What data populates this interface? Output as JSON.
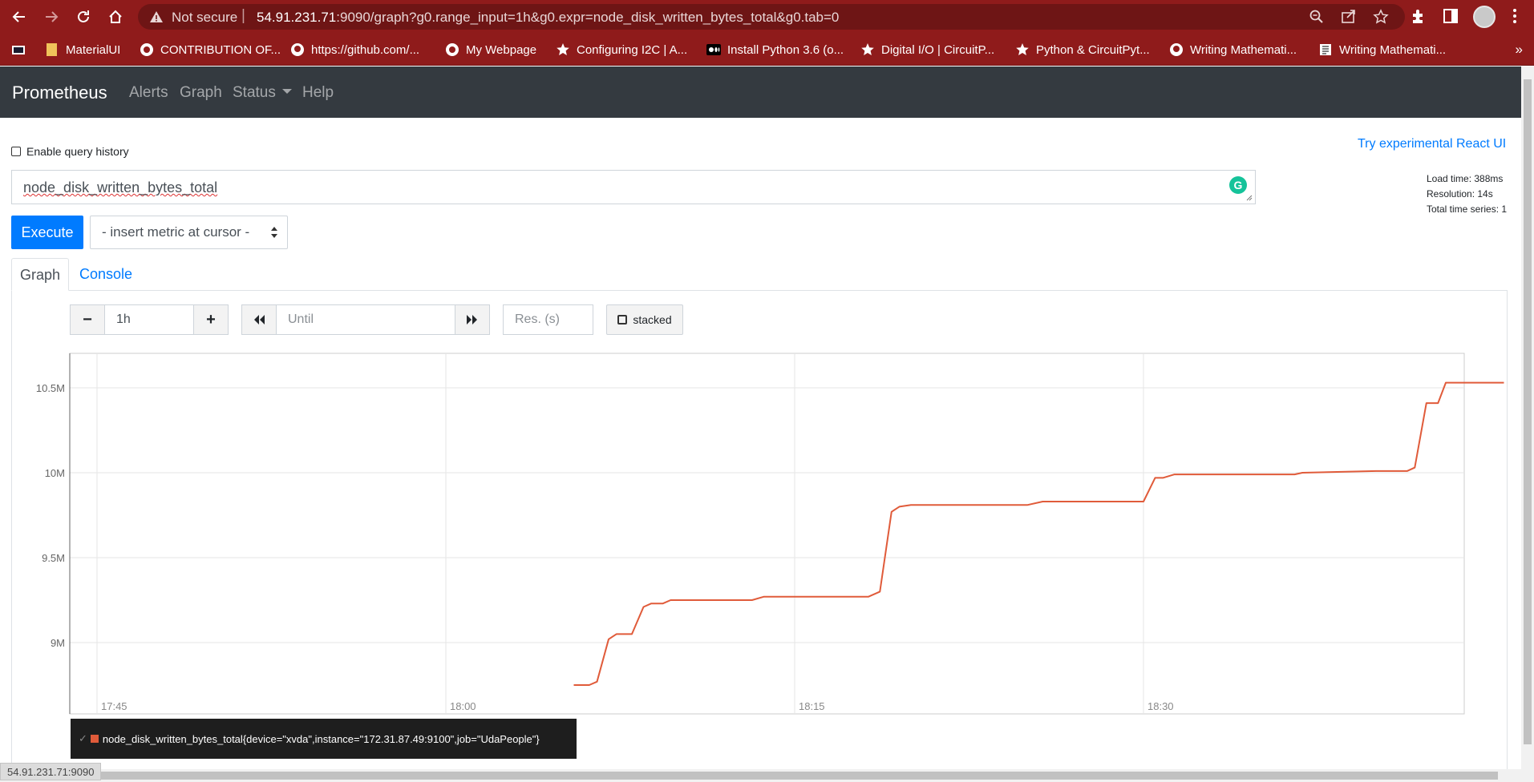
{
  "browser": {
    "not_secure": "Not secure",
    "url_host": "54.91.231.71",
    "url_rest": ":9090/graph?g0.range_input=1h&g0.expr=node_disk_written_bytes_total&g0.tab=0",
    "status_url": "54.91.231.71:9090"
  },
  "bookmarks": [
    {
      "label": "MaterialUI",
      "icon": "folder-icon"
    },
    {
      "label": "CONTRIBUTION OF...",
      "icon": "globe-icon"
    },
    {
      "label": "https://github.com/...",
      "icon": "github-icon"
    },
    {
      "label": "My Webpage",
      "icon": "globe-icon"
    },
    {
      "label": "Configuring I2C | A...",
      "icon": "star-badge-icon"
    },
    {
      "label": "Install Python 3.6 (o...",
      "icon": "medium-icon"
    },
    {
      "label": "Digital I/O | CircuitP...",
      "icon": "star-badge-icon"
    },
    {
      "label": "Python & CircuitPyt...",
      "icon": "star-badge-icon"
    },
    {
      "label": "Writing Mathemati...",
      "icon": "github-icon"
    },
    {
      "label": "Writing Mathemati...",
      "icon": "doc-icon"
    }
  ],
  "navbar": {
    "brand": "Prometheus",
    "links": [
      "Alerts",
      "Graph",
      "Status",
      "Help"
    ]
  },
  "query": {
    "history_label": "Enable query history",
    "react_link": "Try experimental React UI",
    "expression": "node_disk_written_bytes_total",
    "stats": [
      "Load time: 388ms",
      "Resolution: 14s",
      "Total time series: 1"
    ],
    "execute_label": "Execute",
    "metric_select": "- insert metric at cursor -"
  },
  "tabs": {
    "graph": "Graph",
    "console": "Console"
  },
  "controls": {
    "range": "1h",
    "until_placeholder": "Until",
    "res_placeholder": "Res. (s)",
    "stacked_label": "stacked"
  },
  "chart_data": {
    "type": "line",
    "x_ticks": [
      "17:45",
      "18:00",
      "18:15",
      "18:30"
    ],
    "y_ticks": [
      "9M",
      "9.5M",
      "10M",
      "10.5M"
    ],
    "ylim": [
      8.6,
      10.8
    ],
    "y_unit": "M",
    "series": [
      {
        "name": "node_disk_written_bytes_total{device=\"xvda\",instance=\"172.31.87.49:9100\",job=\"UdaPeople\"}",
        "color": "#e05b3a",
        "points": [
          [
            "18:05:30",
            8.75
          ],
          [
            "18:06:10",
            8.75
          ],
          [
            "18:06:30",
            8.77
          ],
          [
            "18:07:00",
            9.02
          ],
          [
            "18:07:20",
            9.05
          ],
          [
            "18:08:00",
            9.05
          ],
          [
            "18:08:30",
            9.21
          ],
          [
            "18:08:50",
            9.23
          ],
          [
            "18:09:20",
            9.23
          ],
          [
            "18:09:40",
            9.25
          ],
          [
            "18:13:10",
            9.25
          ],
          [
            "18:13:40",
            9.27
          ],
          [
            "18:18:10",
            9.27
          ],
          [
            "18:18:40",
            9.3
          ],
          [
            "18:19:10",
            9.77
          ],
          [
            "18:19:30",
            9.8
          ],
          [
            "18:20:00",
            9.81
          ],
          [
            "18:23:40",
            9.81
          ],
          [
            "18:25:00",
            9.81
          ],
          [
            "18:25:40",
            9.83
          ],
          [
            "18:30:00",
            9.83
          ],
          [
            "18:30:30",
            9.97
          ],
          [
            "18:30:50",
            9.97
          ],
          [
            "18:31:20",
            9.99
          ],
          [
            "18:36:30",
            9.99
          ],
          [
            "18:36:50",
            10.0
          ],
          [
            "18:40:00",
            10.01
          ],
          [
            "18:41:20",
            10.01
          ],
          [
            "18:41:40",
            10.03
          ],
          [
            "18:42:10",
            10.41
          ],
          [
            "18:42:40",
            10.41
          ],
          [
            "18:43:00",
            10.53
          ],
          [
            "18:45:30",
            10.53
          ]
        ]
      }
    ]
  },
  "colors": {
    "chrome": "#8f1b1b",
    "navbar": "#343a40",
    "primary": "#007bff",
    "series": "#e05b3a"
  }
}
